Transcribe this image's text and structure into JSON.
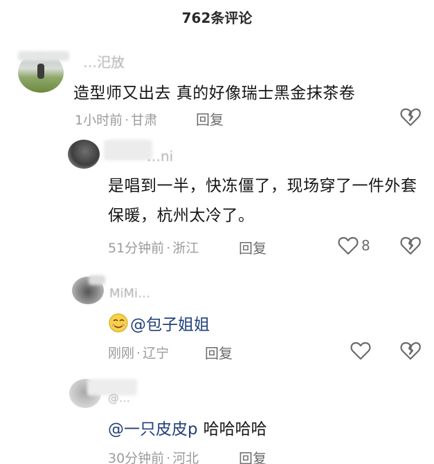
{
  "header": {
    "title": "762条评论"
  },
  "comments": [
    {
      "username": "…汜放",
      "text": "造型师又出去  真的好像瑞士黑金抹茶卷",
      "time": "1小时前",
      "location": "甘肃",
      "reply_label": "回复"
    },
    {
      "username": "…ni",
      "text": "是唱到一半，快冻僵了，现场穿了一件外套保暖，杭州太冷了。",
      "time": "51分钟前",
      "location": "浙江",
      "reply_label": "回复",
      "like_count": "8"
    },
    {
      "username": "MiMi…",
      "mention": "@包子姐姐",
      "time": "刚刚",
      "location": "辽宁",
      "reply_label": "回复"
    },
    {
      "username": "@…",
      "mention": "@一只皮皮p",
      "text": "哈哈哈哈",
      "time": "30分钟前",
      "location": "河北",
      "reply_label": "回复"
    }
  ],
  "icons": {
    "like": "heart-outline-icon",
    "dislike": "broken-heart-icon",
    "emoji": "smile-emoji-icon"
  },
  "colors": {
    "text": "#151515",
    "meta": "#9b9b9b",
    "reply": "#6b6b6b",
    "mention": "#1f3f7a"
  }
}
